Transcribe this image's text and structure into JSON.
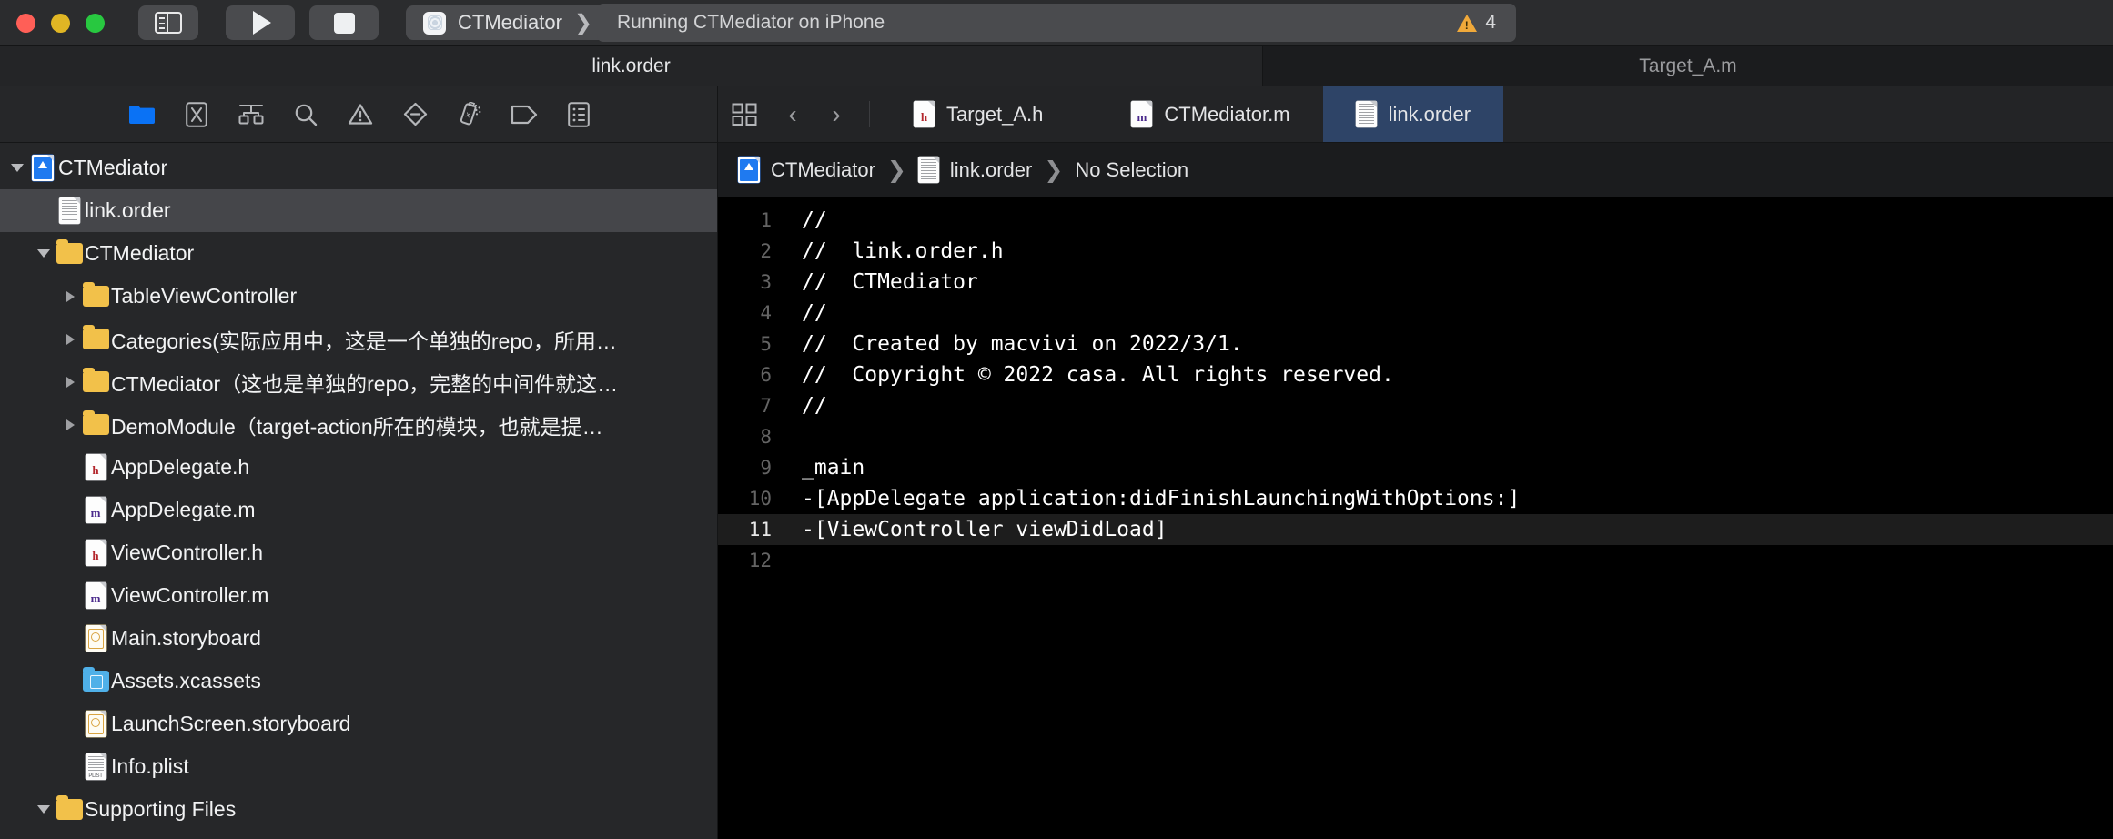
{
  "titlebar": {
    "window_buttons": [
      "close",
      "minimize",
      "zoom"
    ],
    "sidebar_toggle": "toggle-navigator",
    "run_label": "Run",
    "stop_label": "Stop",
    "scheme": {
      "scheme_name": "CTMediator",
      "separator": "❯",
      "destination": "iPhone"
    },
    "status": {
      "text": "Running CTMediator on iPhone",
      "warning_count": "4"
    }
  },
  "subtitle": {
    "left_title": "link.order",
    "right_title": "Target_A.m"
  },
  "navigator": {
    "toolbar_icons": [
      "project-navigator-icon",
      "source-control-navigator-icon",
      "symbol-navigator-icon",
      "find-navigator-icon",
      "issue-navigator-icon",
      "test-navigator-icon",
      "debug-navigator-icon",
      "breakpoint-navigator-icon",
      "report-navigator-icon"
    ],
    "tree": [
      {
        "label": "CTMediator",
        "icon": "xcode-project-icon",
        "indent": 0,
        "twisty": "open",
        "selected": false
      },
      {
        "label": "link.order",
        "icon": "generic-file-icon",
        "indent": 1,
        "twisty": "none",
        "selected": true
      },
      {
        "label": "CTMediator",
        "icon": "folder-icon",
        "indent": 1,
        "twisty": "open",
        "selected": false
      },
      {
        "label": "TableViewController",
        "icon": "folder-icon",
        "indent": 2,
        "twisty": "closed",
        "selected": false
      },
      {
        "label": "Categories(实际应用中，这是一个单独的repo，所用…",
        "icon": "folder-icon",
        "indent": 2,
        "twisty": "closed",
        "selected": false
      },
      {
        "label": "CTMediator（这也是单独的repo，完整的中间件就这…",
        "icon": "folder-icon",
        "indent": 2,
        "twisty": "closed",
        "selected": false
      },
      {
        "label": "DemoModule（target-action所在的模块，也就是提…",
        "icon": "folder-icon",
        "indent": 2,
        "twisty": "closed",
        "selected": false
      },
      {
        "label": "AppDelegate.h",
        "icon": "header-file-icon",
        "indent": 2,
        "twisty": "none",
        "selected": false
      },
      {
        "label": "AppDelegate.m",
        "icon": "objc-file-icon",
        "indent": 2,
        "twisty": "none",
        "selected": false
      },
      {
        "label": "ViewController.h",
        "icon": "header-file-icon",
        "indent": 2,
        "twisty": "none",
        "selected": false
      },
      {
        "label": "ViewController.m",
        "icon": "objc-file-icon",
        "indent": 2,
        "twisty": "none",
        "selected": false
      },
      {
        "label": "Main.storyboard",
        "icon": "storyboard-icon",
        "indent": 2,
        "twisty": "none",
        "selected": false
      },
      {
        "label": "Assets.xcassets",
        "icon": "xcassets-icon",
        "indent": 2,
        "twisty": "none",
        "selected": false
      },
      {
        "label": "LaunchScreen.storyboard",
        "icon": "storyboard-icon",
        "indent": 2,
        "twisty": "none",
        "selected": false
      },
      {
        "label": "Info.plist",
        "icon": "plist-icon",
        "indent": 2,
        "twisty": "none",
        "selected": false
      },
      {
        "label": "Supporting Files",
        "icon": "folder-icon",
        "indent": 1,
        "twisty": "open",
        "selected": false
      }
    ]
  },
  "editor": {
    "tab_chooser_icon": "editor-options-icon",
    "back_label": "‹",
    "forward_label": "›",
    "tabs": [
      {
        "label": "Target_A.h",
        "icon": "header-file-icon",
        "active": false
      },
      {
        "label": "CTMediator.m",
        "icon": "objc-file-icon",
        "active": false
      },
      {
        "label": "link.order",
        "icon": "generic-file-icon",
        "active": true
      }
    ],
    "breadcrumb": [
      {
        "label": "CTMediator",
        "icon": "xcode-project-icon"
      },
      {
        "label": "link.order",
        "icon": "generic-file-icon"
      },
      {
        "label": "No Selection",
        "icon": "none"
      }
    ],
    "breadcrumb_separator": "❯",
    "lines": [
      {
        "n": "1",
        "text": "//",
        "highlight": false
      },
      {
        "n": "2",
        "text": "//  link.order.h",
        "highlight": false
      },
      {
        "n": "3",
        "text": "//  CTMediator",
        "highlight": false
      },
      {
        "n": "4",
        "text": "//",
        "highlight": false
      },
      {
        "n": "5",
        "text": "//  Created by macvivi on 2022/3/1.",
        "highlight": false
      },
      {
        "n": "6",
        "text": "//  Copyright © 2022 casa. All rights reserved.",
        "highlight": false
      },
      {
        "n": "7",
        "text": "//",
        "highlight": false
      },
      {
        "n": "8",
        "text": "",
        "highlight": false
      },
      {
        "n": "9",
        "text": "_main",
        "highlight": false
      },
      {
        "n": "10",
        "text": "-[AppDelegate application:didFinishLaunchingWithOptions:]",
        "highlight": false
      },
      {
        "n": "11",
        "text": "-[ViewController viewDidLoad]",
        "highlight": true
      },
      {
        "n": "12",
        "text": "",
        "highlight": false
      }
    ]
  },
  "colors": {
    "titlebar_bg": "#2b2c2e",
    "navigator_bg": "#262729",
    "editor_bg": "#000000",
    "active_tab_bg": "#2e4467",
    "selected_row_bg": "#45464a",
    "accent_blue": "#1f7af0",
    "warning_yellow": "#f0a93a"
  }
}
